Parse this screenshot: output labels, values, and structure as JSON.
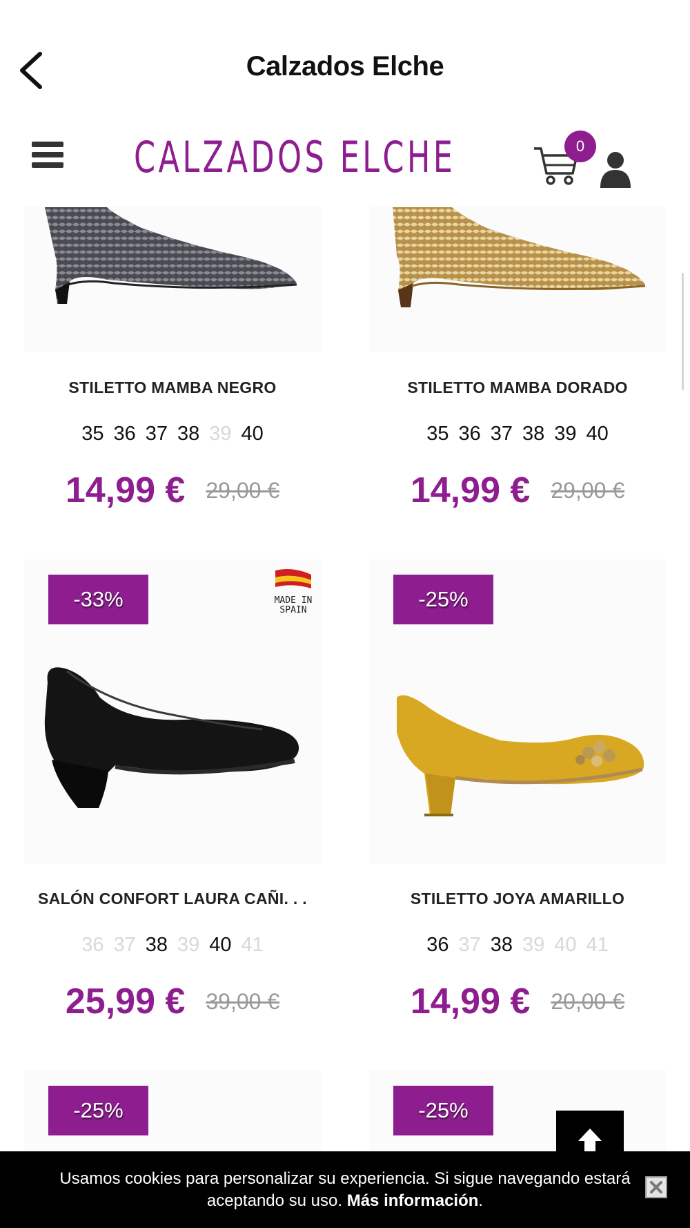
{
  "app_bar": {
    "title": "Calzados Elche"
  },
  "store_header": {
    "logo_text": "CALZADOS ELCHE",
    "cart_count": "0"
  },
  "products": [
    {
      "name": "STILETTO MAMBA NEGRO",
      "sizes": [
        {
          "label": "35",
          "available": true
        },
        {
          "label": "36",
          "available": true
        },
        {
          "label": "37",
          "available": true
        },
        {
          "label": "38",
          "available": true
        },
        {
          "label": "39",
          "available": false
        },
        {
          "label": "40",
          "available": true
        }
      ],
      "price": "14,99 €",
      "old_price": "29,00 €"
    },
    {
      "name": "STILETTO MAMBA DORADO",
      "sizes": [
        {
          "label": "35",
          "available": true
        },
        {
          "label": "36",
          "available": true
        },
        {
          "label": "37",
          "available": true
        },
        {
          "label": "38",
          "available": true
        },
        {
          "label": "39",
          "available": true
        },
        {
          "label": "40",
          "available": true
        }
      ],
      "price": "14,99 €",
      "old_price": "29,00 €"
    },
    {
      "badge": "-33%",
      "made_in_spain": "MADE IN SPAIN",
      "name": "SALÓN CONFORT LAURA CAÑI. . .",
      "sizes": [
        {
          "label": "36",
          "available": false
        },
        {
          "label": "37",
          "available": false
        },
        {
          "label": "38",
          "available": true
        },
        {
          "label": "39",
          "available": false
        },
        {
          "label": "40",
          "available": true
        },
        {
          "label": "41",
          "available": false
        }
      ],
      "price": "25,99 €",
      "old_price": "39,00 €"
    },
    {
      "badge": "-25%",
      "name": "STILETTO JOYA AMARILLO",
      "sizes": [
        {
          "label": "36",
          "available": true
        },
        {
          "label": "37",
          "available": false
        },
        {
          "label": "38",
          "available": true
        },
        {
          "label": "39",
          "available": false
        },
        {
          "label": "40",
          "available": false
        },
        {
          "label": "41",
          "available": false
        }
      ],
      "price": "14,99 €",
      "old_price": "20,00 €"
    },
    {
      "badge": "-25%"
    },
    {
      "badge": "-25%"
    }
  ],
  "cookie_bar": {
    "text": "Usamos cookies para personalizar su experiencia. Si sigue navegando estará aceptando su uso.",
    "link": "Más información",
    "end": "."
  },
  "colors": {
    "accent": "#8e1e8f",
    "badge_text": "#ffffff",
    "cookie_bg": "#000000"
  },
  "icons": {
    "back": "chevron-left-icon",
    "menu": "hamburger-icon",
    "cart": "cart-icon",
    "user": "user-icon",
    "top": "arrow-up-icon",
    "close": "close-icon"
  }
}
